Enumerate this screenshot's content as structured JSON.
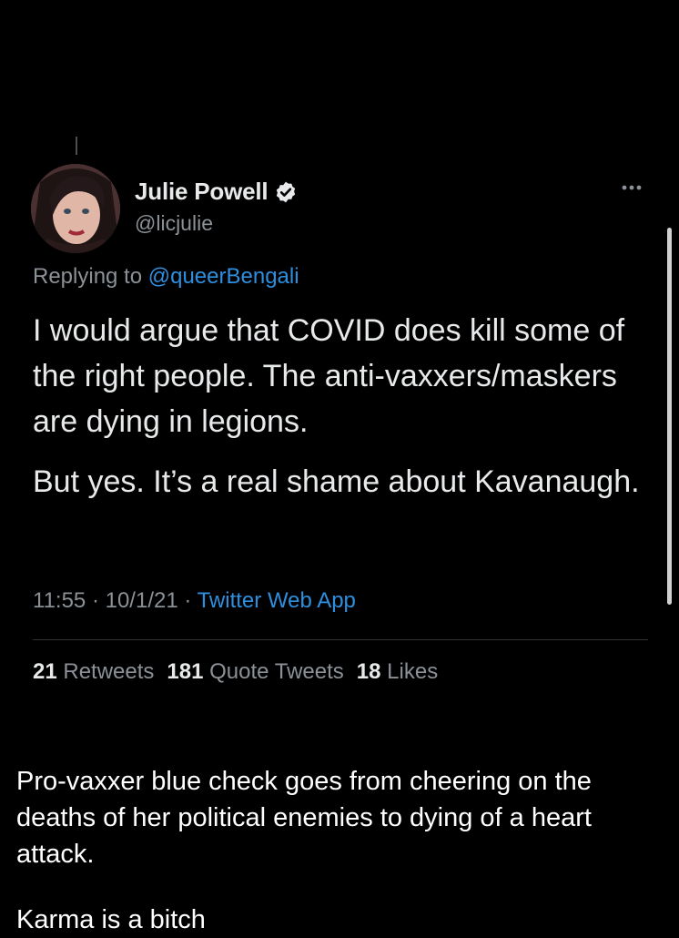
{
  "tweet": {
    "author": {
      "display_name": "Julie Powell",
      "handle": "@licjulie",
      "verified": true
    },
    "replying_prefix": "Replying to ",
    "replying_to": "@queerBengali",
    "paragraphs": [
      "I would argue that COVID does kill some of the right people. The anti-vaxxers/maskers are dying in legions.",
      "But yes. It’s a real shame about Kavanaugh."
    ],
    "time": "11:55",
    "separator": " · ",
    "date": "10/1/21",
    "source": "Twitter Web App",
    "stats": {
      "retweets_count": "21",
      "retweets_label": "Retweets",
      "quote_count": "181",
      "quote_label": "Quote Tweets",
      "likes_count": "18",
      "likes_label": "Likes"
    }
  },
  "caption": {
    "line1": "Pro-vaxxer blue check goes from cheering on the deaths of her political enemies to dying of a heart attack.",
    "line2": "Karma is a bitch"
  },
  "icons": {
    "verified": "verified-badge-icon",
    "more": "more-options-icon"
  },
  "colors": {
    "background": "#000000",
    "text": "#e7e9ea",
    "secondary": "#8b9196",
    "link": "#2f8fdf"
  }
}
